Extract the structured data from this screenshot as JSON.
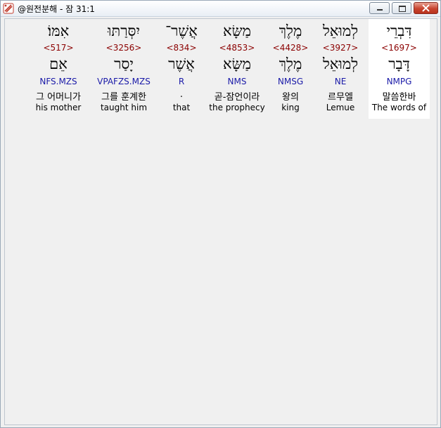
{
  "window": {
    "title": "@원전분해 - 잠 31:1"
  },
  "colors": {
    "strong_number": "#8b0000",
    "morphology": "#1a1aa8",
    "selected_background": "#ffffff",
    "panel_background": "#f0f0f0"
  },
  "words": [
    {
      "surface": "דִּבְרֵי",
      "strong": "<1697>",
      "lemma": "דָּבָר",
      "morph": "NMPG",
      "korean": "말씀한바",
      "english": "The words of",
      "selected": true
    },
    {
      "surface": "לְמוּאֵל",
      "strong": "<3927>",
      "lemma": "לְמוּאֵל",
      "morph": "NE",
      "korean": "르무엘",
      "english": "Lemue",
      "selected": false
    },
    {
      "surface": "מֶלֶךְ",
      "strong": "<4428>",
      "lemma": "מֶלֶךְ",
      "morph": "NMSG",
      "korean": "왕의",
      "english": "king",
      "selected": false
    },
    {
      "surface": "מַשָּׂא",
      "strong": "<4853>",
      "lemma": "מַשָּׂא",
      "morph": "NMS",
      "korean": "곧-잠언이라",
      "english": "the prophecy",
      "selected": false
    },
    {
      "surface": "אֲשֶׁר־",
      "strong": "<834>",
      "lemma": "אֲשֶׁר",
      "morph": "R",
      "korean": ".",
      "english": "that",
      "selected": false
    },
    {
      "surface": "יִסְּרַתּוּ",
      "strong": "<3256>",
      "lemma": "יָסַר",
      "morph": "VPAFZS.MZS",
      "korean": "그를 훈계한",
      "english": "taught him",
      "selected": false
    },
    {
      "surface": "אִמּוֹ׃",
      "strong": "<517>",
      "lemma": "אֵם",
      "morph": "NFS.MZS",
      "korean": "그 어머니가",
      "english": "his mother",
      "selected": false
    }
  ]
}
